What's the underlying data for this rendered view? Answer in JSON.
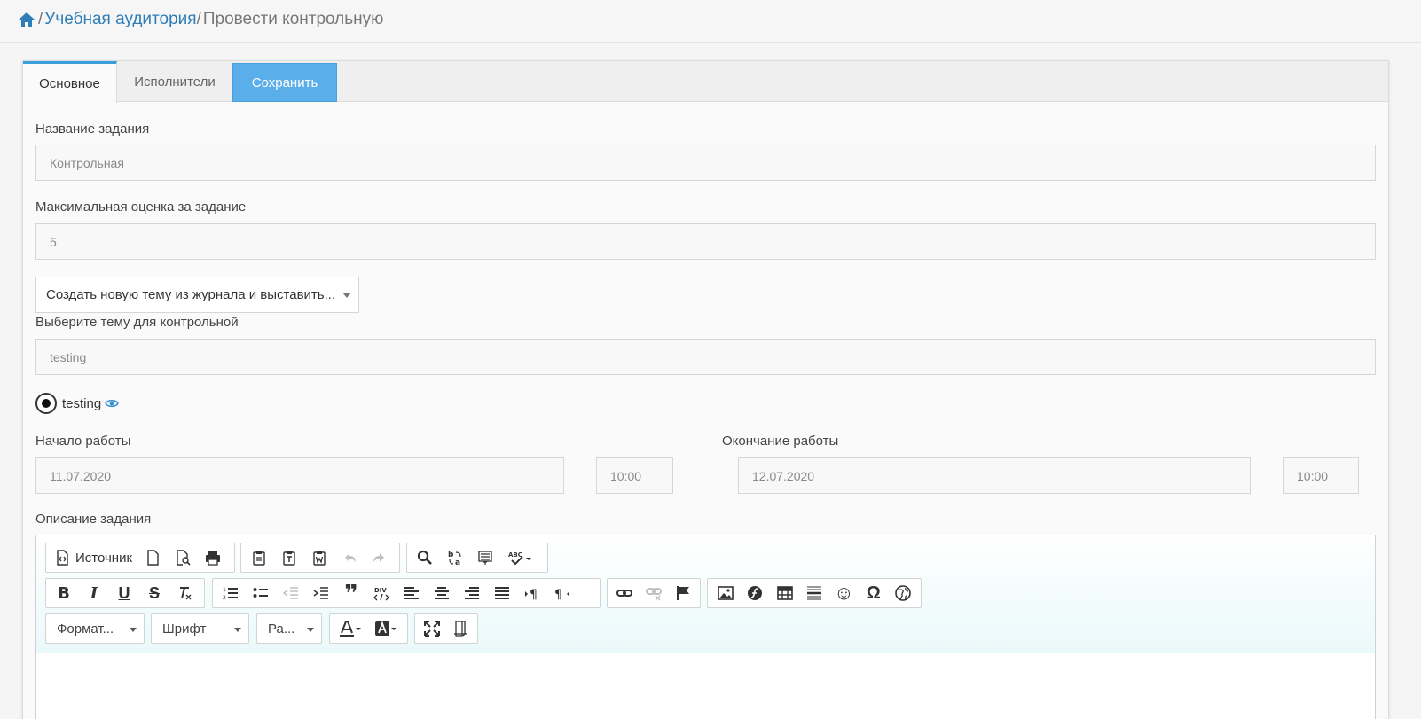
{
  "breadcrumb": {
    "separator": "/",
    "link_label": "Учебная аудитория",
    "current_label": "Провести контрольную"
  },
  "tabs": {
    "main": "Основное",
    "executors": "Исполнители",
    "save": "Сохранить"
  },
  "form": {
    "task_name_label": "Название задания",
    "task_name_value": "Контрольная",
    "max_grade_label": "Максимальная оценка за задание",
    "max_grade_value": "5",
    "topic_mode_selected": "Создать новую тему из журнала и выставить...",
    "topic_label": "Выберите тему для контрольной",
    "topic_value": "testing",
    "radio_option": "testing",
    "start_label": "Начало работы",
    "start_date": "11.07.2020",
    "start_time": "10:00",
    "end_label": "Окончание работы",
    "end_date": "12.07.2020",
    "end_time": "10:00",
    "description_label": "Описание задания"
  },
  "editor": {
    "source_label": "Источник",
    "format_label": "Формат...",
    "font_label": "Шрифт",
    "size_label": "Ра...",
    "bold_glyph": "B",
    "italic_glyph": "I",
    "underline_glyph": "U",
    "strike_glyph": "S",
    "quote_glyph": "❞",
    "smiley_glyph": "☺",
    "omega_glyph": "Ω"
  },
  "colors": {
    "accent": "#3aa0dd",
    "save_button": "#5aafea",
    "link": "#2f7db7"
  }
}
